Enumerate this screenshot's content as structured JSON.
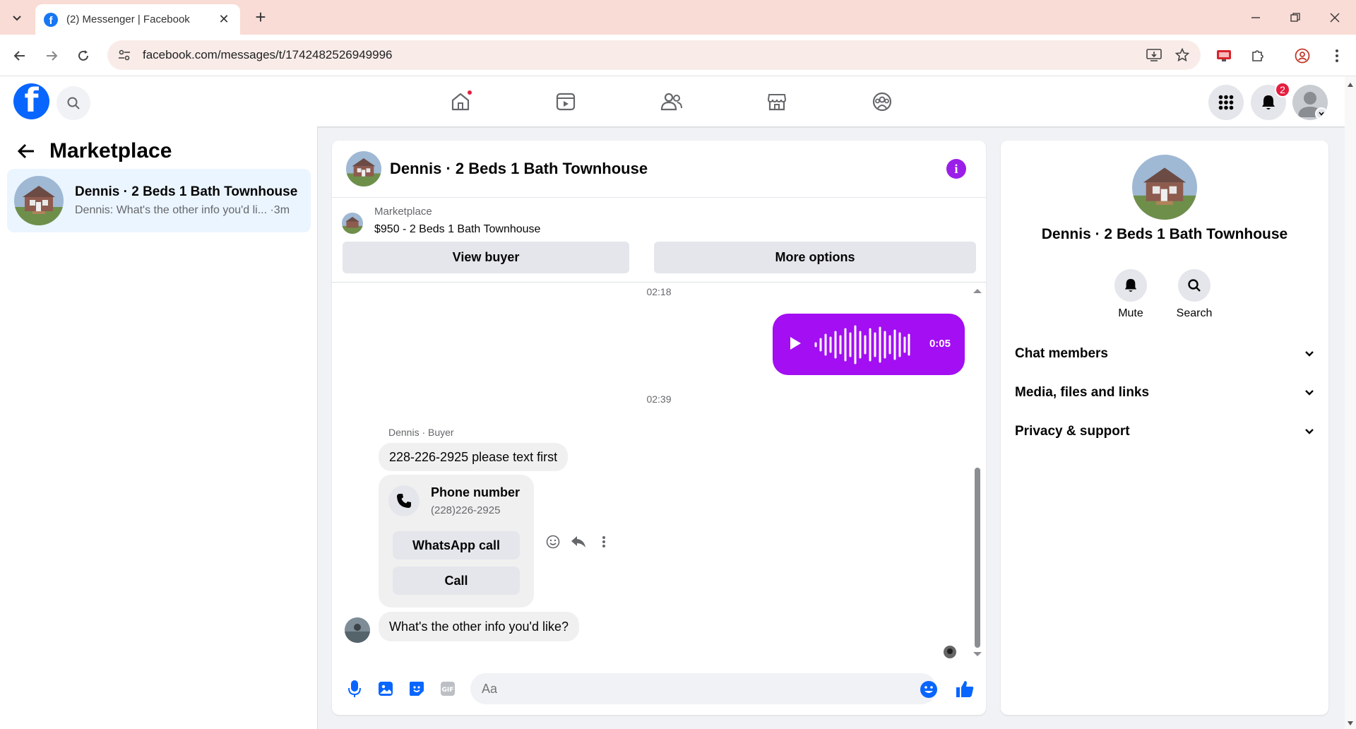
{
  "browser": {
    "tab_title": "(2) Messenger | Facebook",
    "url": "facebook.com/messages/t/1742482526949996"
  },
  "fb_nav": {
    "notification_count": "2"
  },
  "left_panel": {
    "title": "Marketplace",
    "conversation": {
      "name": "Dennis · 2 Beds 1 Bath Townhouse",
      "preview": "Dennis: What's the other info you'd li... ·3m"
    }
  },
  "chat": {
    "header_name": "Dennis · 2 Beds 1 Bath Townhouse",
    "listing_source": "Marketplace",
    "listing_title": "$950 - 2 Beds 1 Bath Townhouse",
    "view_buyer_label": "View buyer",
    "more_options_label": "More options",
    "timestamp_1": "02:18",
    "voice_duration": "0:05",
    "timestamp_2": "02:39",
    "sender_label": "Dennis · Buyer",
    "msg_1": "228-226-2925 please text first",
    "phone_card": {
      "title": "Phone number",
      "number": "(228)226-2925",
      "whatsapp_label": "WhatsApp call",
      "call_label": "Call"
    },
    "msg_2": "What's the other info you'd like?",
    "composer_placeholder": "Aa"
  },
  "right_panel": {
    "name": "Dennis · 2 Beds 1 Bath Townhouse",
    "mute_label": "Mute",
    "search_label": "Search",
    "sections": [
      "Chat members",
      "Media, files and links",
      "Privacy & support"
    ]
  },
  "colors": {
    "fb_blue": "#0866ff",
    "messenger_purple": "#a30ef2",
    "conversation_highlight": "#ebf5ff",
    "badge_red": "#e41e3f"
  }
}
